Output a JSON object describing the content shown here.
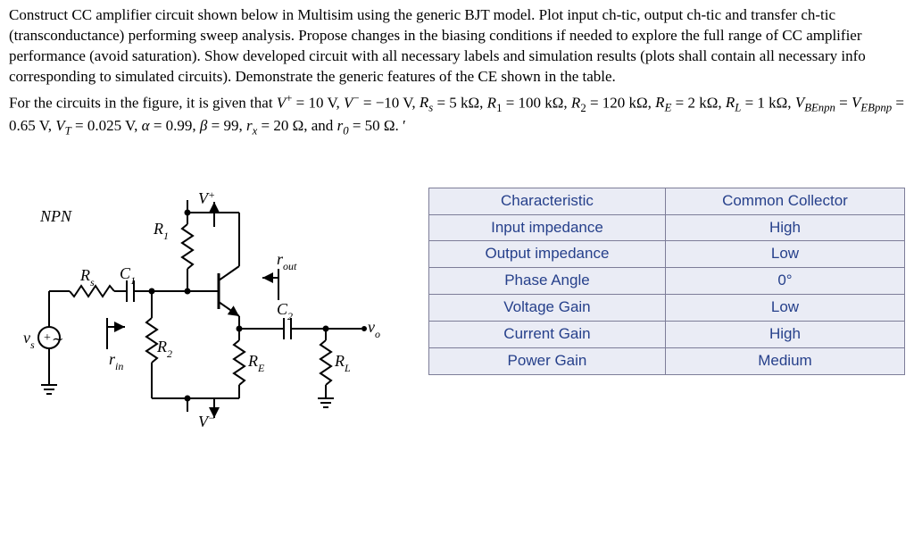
{
  "paragraph1": "Construct CC amplifier circuit shown below in Multisim using the generic BJT model. Plot input ch-tic, output ch-tic and transfer ch-tic (transconductance) performing sweep analysis. Propose changes in the biasing conditions if needed to explore the full range of CC amplifier performance (avoid saturation). Show developed circuit with all necessary labels and simulation results (plots shall contain all necessary info corresponding to simulated circuits). Demonstrate the generic features of the CE shown in the table.",
  "paragraph2": "For the circuits in the figure, it is given that V⁺ = 10 V, V⁻ = −10 V, Rₛ = 5 kΩ, R₁ = 100 kΩ, R₂ = 120 kΩ, R_E = 2 kΩ, R_L = 1 kΩ, V_BEnpn = V_EBpnp = 0.65 V, V_T = 0.025 V, α = 0.99, β = 99, rₓ = 20 Ω, and r₀ = 50 Ω. ′",
  "circuit": {
    "labels": {
      "npn": "NPN",
      "Vplus": "V",
      "VplusSign": "+",
      "Vminus": "V",
      "VminusSign": "−",
      "R1": "R",
      "R1sub": "1",
      "R2": "R",
      "R2sub": "2",
      "Rs": "R",
      "Rssub": "s",
      "RE": "R",
      "REsub": "E",
      "RL": "R",
      "RLsub": "L",
      "C1": "C",
      "C1sub": "1",
      "C2": "C",
      "C2sub": "2",
      "vs": "v",
      "vssub": "s",
      "vo": "v",
      "vosub": "o",
      "rin": "r",
      "rinsub": "in",
      "rout": "r",
      "routsub": "out"
    }
  },
  "table": {
    "headers": [
      "Characteristic",
      "Common Collector"
    ],
    "rows": [
      [
        "Input impedance",
        "High"
      ],
      [
        "Output impedance",
        "Low"
      ],
      [
        "Phase Angle",
        "0°"
      ],
      [
        "Voltage Gain",
        "Low"
      ],
      [
        "Current Gain",
        "High"
      ],
      [
        "Power Gain",
        "Medium"
      ]
    ]
  }
}
